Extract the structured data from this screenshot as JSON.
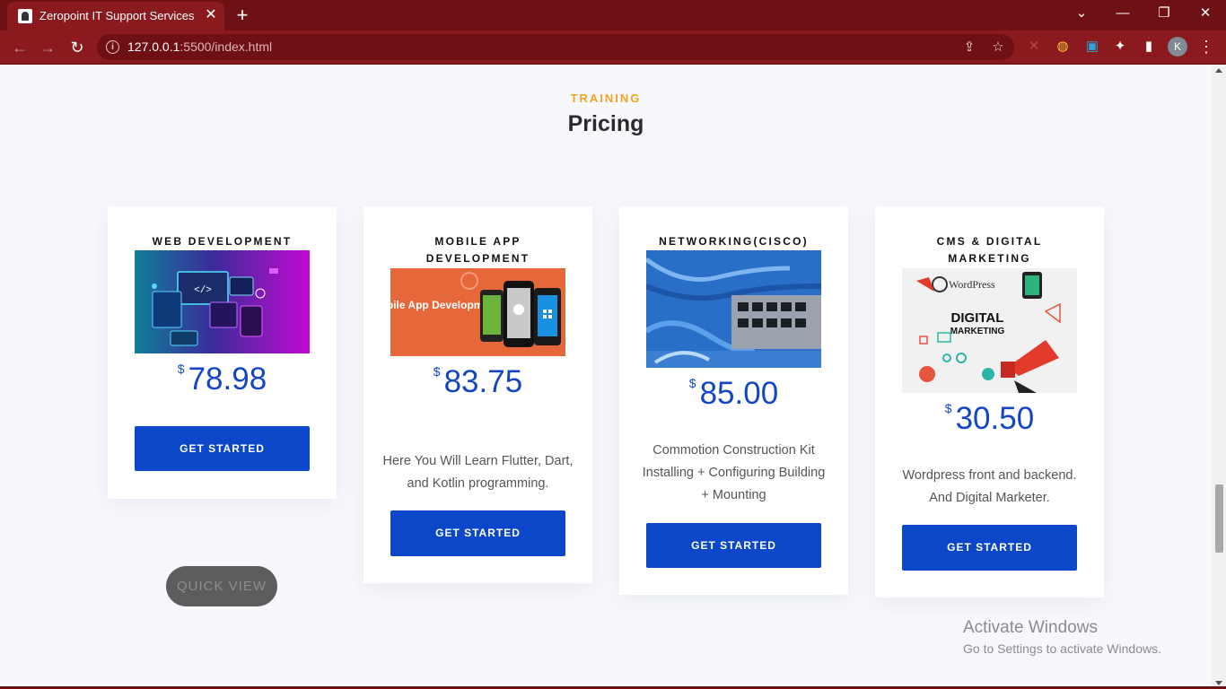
{
  "browser": {
    "tab_title": "Zeropoint IT Support Services",
    "tab_close": "✕",
    "new_tab": "+",
    "url_host": "127.0.0.1",
    "url_path": ":5500/index.html",
    "profile_initial": "K",
    "window": {
      "dropdown": "⌄",
      "minimize": "—",
      "restore": "❐",
      "close": "✕"
    },
    "nav": {
      "back": "←",
      "forward": "→",
      "reload": "↻"
    },
    "icons": {
      "info": "i",
      "share": "⇪",
      "star": "☆",
      "ext1": "✕",
      "ext2": "◍",
      "ext3": "▣",
      "puzzle": "✦",
      "sidepanel": "▮",
      "menu": "⋮"
    }
  },
  "section": {
    "subtitle": "TRAINING",
    "title": "Pricing"
  },
  "cards": [
    {
      "title": "WEB DEVELOPMENT",
      "currency": "$",
      "price": "78.98",
      "description": "",
      "button": "GET STARTED",
      "image": "web-development-image"
    },
    {
      "title": "MOBILE APP DEVELOPMENT",
      "currency": "$",
      "price": "83.75",
      "description": "Here You Will Learn Flutter, Dart, and Kotlin programming.",
      "button": "GET STARTED",
      "image": "mobile-app-development-image",
      "image_text": "Mobile App Development"
    },
    {
      "title": "NETWORKING(CISCO)",
      "currency": "$",
      "price": "85.00",
      "description": "Commotion Construction Kit Installing + Configuring Building + Mounting",
      "button": "GET STARTED",
      "image": "network-switch-image"
    },
    {
      "title": "CMS & DIGITAL MARKETING",
      "currency": "$",
      "price": "30.50",
      "description": "Wordpress front and backend. And Digital Marketer.",
      "button": "GET STARTED",
      "image": "digital-marketing-image",
      "image_text_1": "WordPress",
      "image_text_2": "DIGITAL",
      "image_text_3": "MARKETING"
    }
  ],
  "quick_view": "QUICK VIEW",
  "watermark": {
    "title": "Activate Windows",
    "subtitle": "Go to Settings to activate Windows."
  },
  "colors": {
    "chrome_dark": "#6e1014",
    "chrome_light": "#8a1a1e",
    "accent_orange": "#f2a324",
    "price_blue": "#1446c4",
    "button_blue": "#0c47c9"
  }
}
